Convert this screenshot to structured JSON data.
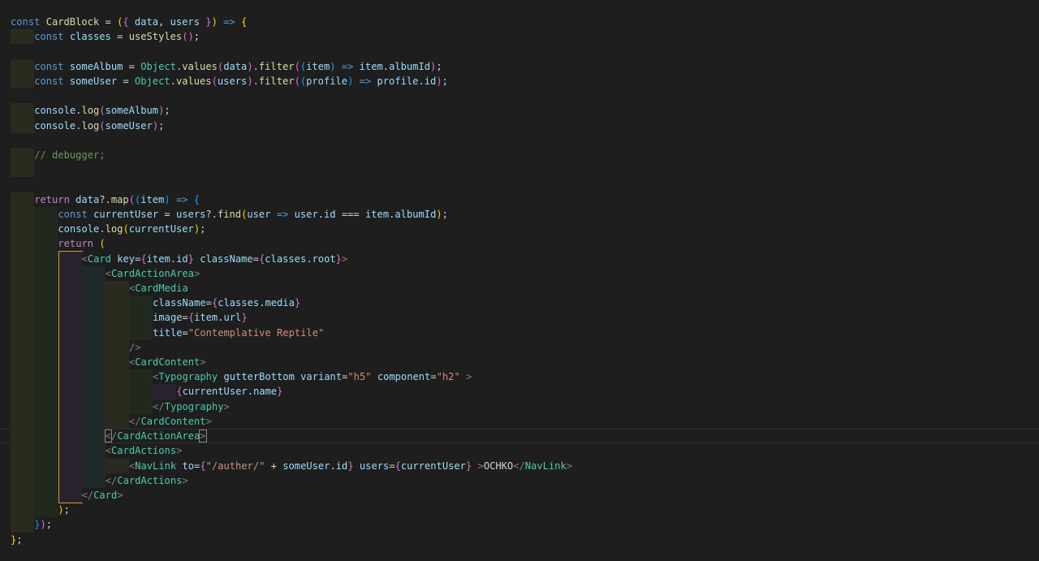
{
  "theme": {
    "background": "#1e1e1e",
    "keyword": "#569cd6",
    "string": "#ce9178",
    "comment": "#6a9955"
  },
  "current_line": 29,
  "code_lines": [
    {
      "i": 0,
      "t": [
        [
          "k",
          "const"
        ],
        [
          "o",
          " "
        ],
        [
          "f",
          "CardBlock"
        ],
        [
          "o",
          " = "
        ],
        [
          "g",
          "("
        ],
        [
          "u",
          "{"
        ],
        [
          "o",
          " "
        ],
        [
          "v",
          "data"
        ],
        [
          "o",
          ", "
        ],
        [
          "v",
          "users"
        ],
        [
          "o",
          " "
        ],
        [
          "u",
          "}"
        ],
        [
          "g",
          ")"
        ],
        [
          "o",
          " "
        ],
        [
          "k",
          "=>"
        ],
        [
          "o",
          " "
        ],
        [
          "g",
          "{"
        ]
      ]
    },
    {
      "i": 1,
      "t": [
        [
          "k",
          "const"
        ],
        [
          "o",
          " "
        ],
        [
          "v",
          "classes"
        ],
        [
          "o",
          " = "
        ],
        [
          "f",
          "useStyles"
        ],
        [
          "u",
          "()"
        ],
        [
          "o",
          ";"
        ]
      ]
    },
    {
      "i": 0,
      "t": []
    },
    {
      "i": 1,
      "t": [
        [
          "k",
          "const"
        ],
        [
          "o",
          " "
        ],
        [
          "v",
          "someAlbum"
        ],
        [
          "o",
          " = "
        ],
        [
          "c",
          "Object"
        ],
        [
          "o",
          "."
        ],
        [
          "f",
          "values"
        ],
        [
          "u",
          "("
        ],
        [
          "v",
          "data"
        ],
        [
          "u",
          ")"
        ],
        [
          "o",
          "."
        ],
        [
          "f",
          "filter"
        ],
        [
          "u",
          "("
        ],
        [
          "b",
          "("
        ],
        [
          "v",
          "item"
        ],
        [
          "b",
          ")"
        ],
        [
          "o",
          " "
        ],
        [
          "k",
          "=>"
        ],
        [
          "o",
          " "
        ],
        [
          "v",
          "item"
        ],
        [
          "o",
          "."
        ],
        [
          "v",
          "albumId"
        ],
        [
          "u",
          ")"
        ],
        [
          "o",
          ";"
        ]
      ]
    },
    {
      "i": 1,
      "t": [
        [
          "k",
          "const"
        ],
        [
          "o",
          " "
        ],
        [
          "v",
          "someUser"
        ],
        [
          "o",
          " = "
        ],
        [
          "c",
          "Object"
        ],
        [
          "o",
          "."
        ],
        [
          "f",
          "values"
        ],
        [
          "u",
          "("
        ],
        [
          "v",
          "users"
        ],
        [
          "u",
          ")"
        ],
        [
          "o",
          "."
        ],
        [
          "f",
          "filter"
        ],
        [
          "u",
          "("
        ],
        [
          "b",
          "("
        ],
        [
          "v",
          "profile"
        ],
        [
          "b",
          ")"
        ],
        [
          "o",
          " "
        ],
        [
          "k",
          "=>"
        ],
        [
          "o",
          " "
        ],
        [
          "v",
          "profile"
        ],
        [
          "o",
          "."
        ],
        [
          "v",
          "id"
        ],
        [
          "u",
          ")"
        ],
        [
          "o",
          ";"
        ]
      ]
    },
    {
      "i": 0,
      "t": []
    },
    {
      "i": 1,
      "t": [
        [
          "v",
          "console"
        ],
        [
          "o",
          "."
        ],
        [
          "f",
          "log"
        ],
        [
          "u",
          "("
        ],
        [
          "v",
          "someAlbum"
        ],
        [
          "u",
          ")"
        ],
        [
          "o",
          ";"
        ]
      ]
    },
    {
      "i": 1,
      "t": [
        [
          "v",
          "console"
        ],
        [
          "o",
          "."
        ],
        [
          "f",
          "log"
        ],
        [
          "u",
          "("
        ],
        [
          "v",
          "someUser"
        ],
        [
          "u",
          ")"
        ],
        [
          "o",
          ";"
        ]
      ]
    },
    {
      "i": 0,
      "t": []
    },
    {
      "i": 1,
      "t": [
        [
          "m",
          "// debugger;"
        ]
      ]
    },
    {
      "i": 1,
      "t": []
    },
    {
      "i": 0,
      "t": []
    },
    {
      "i": 1,
      "t": [
        [
          "r",
          "return"
        ],
        [
          "o",
          " "
        ],
        [
          "v",
          "data"
        ],
        [
          "o",
          "?."
        ],
        [
          "f",
          "map"
        ],
        [
          "u",
          "("
        ],
        [
          "b",
          "("
        ],
        [
          "v",
          "item"
        ],
        [
          "b",
          ")"
        ],
        [
          "o",
          " "
        ],
        [
          "k",
          "=>"
        ],
        [
          "o",
          " "
        ],
        [
          "b",
          "{"
        ]
      ]
    },
    {
      "i": 2,
      "t": [
        [
          "k",
          "const"
        ],
        [
          "o",
          " "
        ],
        [
          "v",
          "currentUser"
        ],
        [
          "o",
          " = "
        ],
        [
          "v",
          "users"
        ],
        [
          "o",
          "?."
        ],
        [
          "f",
          "find"
        ],
        [
          "g",
          "("
        ],
        [
          "v",
          "user"
        ],
        [
          "o",
          " "
        ],
        [
          "k",
          "=>"
        ],
        [
          "o",
          " "
        ],
        [
          "v",
          "user"
        ],
        [
          "o",
          "."
        ],
        [
          "v",
          "id"
        ],
        [
          "o",
          " === "
        ],
        [
          "v",
          "item"
        ],
        [
          "o",
          "."
        ],
        [
          "v",
          "albumId"
        ],
        [
          "g",
          ")"
        ],
        [
          "o",
          ";"
        ]
      ]
    },
    {
      "i": 2,
      "t": [
        [
          "v",
          "console"
        ],
        [
          "o",
          "."
        ],
        [
          "f",
          "log"
        ],
        [
          "g",
          "("
        ],
        [
          "v",
          "currentUser"
        ],
        [
          "g",
          ")"
        ],
        [
          "o",
          ";"
        ]
      ]
    },
    {
      "i": 2,
      "t": [
        [
          "r",
          "return"
        ],
        [
          "o",
          " "
        ],
        [
          "g",
          "("
        ]
      ]
    },
    {
      "i": 3,
      "t": [
        [
          "p",
          "<"
        ],
        [
          "t",
          "Card"
        ],
        [
          "o",
          " "
        ],
        [
          "a",
          "key"
        ],
        [
          "o",
          "="
        ],
        [
          "u",
          "{"
        ],
        [
          "v",
          "item"
        ],
        [
          "o",
          "."
        ],
        [
          "v",
          "id"
        ],
        [
          "u",
          "}"
        ],
        [
          "o",
          " "
        ],
        [
          "a",
          "className"
        ],
        [
          "o",
          "="
        ],
        [
          "u",
          "{"
        ],
        [
          "v",
          "classes"
        ],
        [
          "o",
          "."
        ],
        [
          "v",
          "root"
        ],
        [
          "u",
          "}"
        ],
        [
          "p",
          ">"
        ]
      ]
    },
    {
      "i": 4,
      "t": [
        [
          "p",
          "<"
        ],
        [
          "t",
          "CardActionArea"
        ],
        [
          "p",
          ">"
        ]
      ]
    },
    {
      "i": 5,
      "t": [
        [
          "p",
          "<"
        ],
        [
          "t",
          "CardMedia"
        ]
      ]
    },
    {
      "i": 6,
      "t": [
        [
          "a",
          "className"
        ],
        [
          "o",
          "="
        ],
        [
          "u",
          "{"
        ],
        [
          "v",
          "classes"
        ],
        [
          "o",
          "."
        ],
        [
          "v",
          "media"
        ],
        [
          "u",
          "}"
        ]
      ]
    },
    {
      "i": 6,
      "t": [
        [
          "a",
          "image"
        ],
        [
          "o",
          "="
        ],
        [
          "u",
          "{"
        ],
        [
          "v",
          "item"
        ],
        [
          "o",
          "."
        ],
        [
          "v",
          "url"
        ],
        [
          "u",
          "}"
        ]
      ]
    },
    {
      "i": 6,
      "t": [
        [
          "a",
          "title"
        ],
        [
          "o",
          "="
        ],
        [
          "s",
          "\"Contemplative Reptile\""
        ]
      ]
    },
    {
      "i": 5,
      "t": [
        [
          "p",
          "/>"
        ]
      ]
    },
    {
      "i": 5,
      "t": [
        [
          "p",
          "<"
        ],
        [
          "t",
          "CardContent"
        ],
        [
          "p",
          ">"
        ]
      ]
    },
    {
      "i": 6,
      "t": [
        [
          "p",
          "<"
        ],
        [
          "t",
          "Typography"
        ],
        [
          "o",
          " "
        ],
        [
          "a",
          "gutterBottom"
        ],
        [
          "o",
          " "
        ],
        [
          "a",
          "variant"
        ],
        [
          "o",
          "="
        ],
        [
          "s",
          "\"h5\""
        ],
        [
          "o",
          " "
        ],
        [
          "a",
          "component"
        ],
        [
          "o",
          "="
        ],
        [
          "s",
          "\"h2\""
        ],
        [
          "o",
          " "
        ],
        [
          "p",
          ">"
        ]
      ]
    },
    {
      "i": 7,
      "t": [
        [
          "u",
          "{"
        ],
        [
          "v",
          "currentUser"
        ],
        [
          "o",
          "."
        ],
        [
          "v",
          "name"
        ],
        [
          "u",
          "}"
        ]
      ]
    },
    {
      "i": 6,
      "t": [
        [
          "p",
          "</"
        ],
        [
          "t",
          "Typography"
        ],
        [
          "p",
          ">"
        ]
      ]
    },
    {
      "i": 5,
      "t": [
        [
          "p",
          "</"
        ],
        [
          "t",
          "CardContent"
        ],
        [
          "p",
          ">"
        ]
      ]
    },
    {
      "i": 4,
      "t": [
        [
          "pbm",
          "<"
        ],
        [
          "p",
          "/"
        ],
        [
          "t",
          "CardActionArea"
        ],
        [
          "pbm",
          ">"
        ]
      ]
    },
    {
      "i": 4,
      "t": [
        [
          "p",
          "<"
        ],
        [
          "t",
          "CardActions"
        ],
        [
          "p",
          ">"
        ]
      ]
    },
    {
      "i": 5,
      "t": [
        [
          "p",
          "<"
        ],
        [
          "t",
          "NavLink"
        ],
        [
          "o",
          " "
        ],
        [
          "a",
          "to"
        ],
        [
          "o",
          "="
        ],
        [
          "u",
          "{"
        ],
        [
          "s",
          "\"/auther/\""
        ],
        [
          "o",
          " + "
        ],
        [
          "v",
          "someUser"
        ],
        [
          "o",
          "."
        ],
        [
          "v",
          "id"
        ],
        [
          "u",
          "}"
        ],
        [
          "o",
          " "
        ],
        [
          "a",
          "users"
        ],
        [
          "o",
          "="
        ],
        [
          "u",
          "{"
        ],
        [
          "v",
          "currentUser"
        ],
        [
          "u",
          "}"
        ],
        [
          "o",
          " "
        ],
        [
          "p",
          ">"
        ],
        [
          "o",
          "OCHKO"
        ],
        [
          "p",
          "</"
        ],
        [
          "t",
          "NavLink"
        ],
        [
          "p",
          ">"
        ]
      ]
    },
    {
      "i": 4,
      "t": [
        [
          "p",
          "</"
        ],
        [
          "t",
          "CardActions"
        ],
        [
          "p",
          ">"
        ]
      ]
    },
    {
      "i": 3,
      "t": [
        [
          "p",
          "</"
        ],
        [
          "t",
          "Card"
        ],
        [
          "p",
          ">"
        ]
      ]
    },
    {
      "i": 2,
      "t": [
        [
          "g",
          ")"
        ],
        [
          "o",
          ";"
        ]
      ]
    },
    {
      "i": 1,
      "t": [
        [
          "b",
          "}"
        ],
        [
          "u",
          ")"
        ],
        [
          "o",
          ";"
        ]
      ]
    },
    {
      "i": 0,
      "t": [
        [
          "g",
          "}"
        ],
        [
          "o",
          ";"
        ]
      ]
    }
  ]
}
